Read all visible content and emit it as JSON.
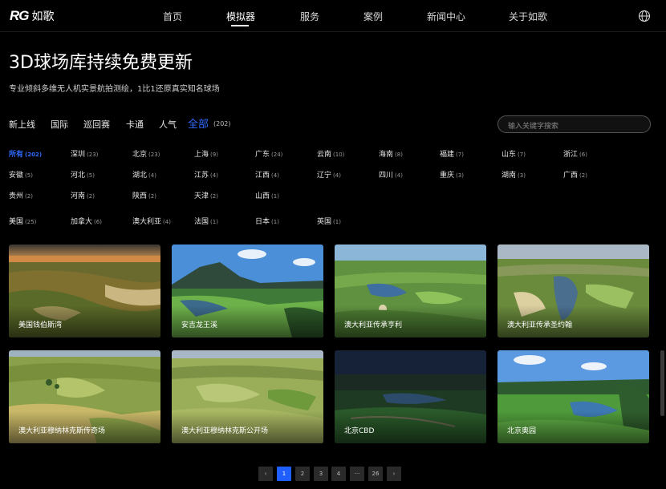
{
  "brand": {
    "logo": "RG",
    "name": "如歌"
  },
  "nav": {
    "items": [
      "首页",
      "模拟器",
      "服务",
      "案例",
      "新闻中心",
      "关于如歌"
    ],
    "active": "模拟器"
  },
  "hero": {
    "title": "3D球场库持续免费更新",
    "subtitle": "专业倾斜多维无人机实景航拍测绘，1比1还原真实知名球场"
  },
  "tabs": {
    "items": [
      "新上线",
      "国际",
      "巡回赛",
      "卡通",
      "人气",
      "全部"
    ],
    "active": "全部",
    "active_count": "(202)"
  },
  "search": {
    "placeholder": "输入关键字搜索"
  },
  "regions": {
    "row1": [
      {
        "name": "所有",
        "count": "(202)"
      },
      {
        "name": "深圳",
        "count": "(23)"
      },
      {
        "name": "北京",
        "count": "(23)"
      },
      {
        "name": "上海",
        "count": "(9)"
      },
      {
        "name": "广东",
        "count": "(24)"
      },
      {
        "name": "云南",
        "count": "(10)"
      },
      {
        "name": "海南",
        "count": "(8)"
      },
      {
        "name": "福建",
        "count": "(7)"
      },
      {
        "name": "山东",
        "count": "(7)"
      },
      {
        "name": "浙江",
        "count": "(6)"
      }
    ],
    "row2": [
      {
        "name": "安徽",
        "count": "(5)"
      },
      {
        "name": "河北",
        "count": "(5)"
      },
      {
        "name": "湖北",
        "count": "(4)"
      },
      {
        "name": "江苏",
        "count": "(4)"
      },
      {
        "name": "江西",
        "count": "(4)"
      },
      {
        "name": "辽宁",
        "count": "(4)"
      },
      {
        "name": "四川",
        "count": "(4)"
      },
      {
        "name": "重庆",
        "count": "(3)"
      },
      {
        "name": "湖南",
        "count": "(3)"
      },
      {
        "name": "广西",
        "count": "(2)"
      }
    ],
    "row3": [
      {
        "name": "贵州",
        "count": "(2)"
      },
      {
        "name": "河南",
        "count": "(2)"
      },
      {
        "name": "陕西",
        "count": "(2)"
      },
      {
        "name": "天津",
        "count": "(2)"
      },
      {
        "name": "山西",
        "count": "(1)"
      }
    ],
    "row4": [
      {
        "name": "美国",
        "count": "(25)"
      },
      {
        "name": "加拿大",
        "count": "(6)"
      },
      {
        "name": "澳大利亚",
        "count": "(4)"
      },
      {
        "name": "法国",
        "count": "(1)"
      },
      {
        "name": "日本",
        "count": "(1)"
      },
      {
        "name": "英国",
        "count": "(1)"
      }
    ]
  },
  "courses": [
    {
      "name": "美国钱伯斯湾"
    },
    {
      "name": "安吉龙王溪"
    },
    {
      "name": "澳大利亚传承亨利"
    },
    {
      "name": "澳大利亚传承圣约翰"
    },
    {
      "name": "澳大利亚穆纳林克斯传奇场"
    },
    {
      "name": "澳大利亚穆纳林克斯公开场"
    },
    {
      "name": "北京CBD"
    },
    {
      "name": "北京奥园"
    }
  ],
  "pagination": {
    "prev": "‹",
    "pages": [
      "1",
      "2",
      "3",
      "4",
      "···",
      "26"
    ],
    "next": "›",
    "current": "1"
  },
  "colors": {
    "accent": "#2f6bff",
    "background": "#000000"
  },
  "icons": {
    "globe": "globe-icon"
  }
}
